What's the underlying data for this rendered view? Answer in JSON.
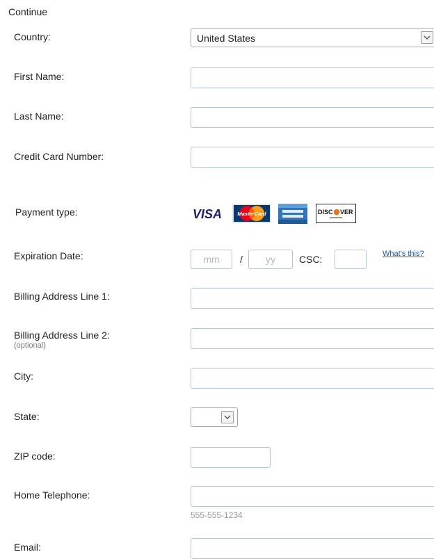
{
  "header": {
    "title": "Continue"
  },
  "form": {
    "country": {
      "label": "Country:",
      "value": "United States"
    },
    "first_name": {
      "label": "First Name:"
    },
    "last_name": {
      "label": "Last Name:"
    },
    "card_number": {
      "label": "Credit Card Number:"
    },
    "payment_type": {
      "label": "Payment type:",
      "cards": [
        {
          "name": "VISA",
          "icon": "visa-logo"
        },
        {
          "name": "MasterCard",
          "icon": "mastercard-logo"
        },
        {
          "name": "AMERICAN EXPRESS",
          "icon": "amex-logo"
        },
        {
          "name": "DISCOVER",
          "icon": "discover-logo"
        }
      ]
    },
    "expiration": {
      "label": "Expiration Date:",
      "month_placeholder": "mm",
      "separator": "/",
      "year_placeholder": "yy",
      "csc_label": "CSC:",
      "help_link": "What's this?"
    },
    "address1": {
      "label": "Billing Address Line 1:"
    },
    "address2": {
      "label": "Billing Address Line 2:",
      "note": "(optional)"
    },
    "city": {
      "label": "City:"
    },
    "state": {
      "label": "State:",
      "value": ""
    },
    "zip": {
      "label": "ZIP code:"
    },
    "phone": {
      "label": "Home Telephone:",
      "hint": "555-555-1234"
    },
    "email": {
      "label": "Email:"
    }
  },
  "colors": {
    "field_border": "#b3c3d8",
    "link": "#1a56a6",
    "visa_blue": "#1a1f71",
    "mastercard_red": "#eb001b",
    "mastercard_orange": "#f79e1b",
    "amex_blue": "#2e77bc"
  }
}
